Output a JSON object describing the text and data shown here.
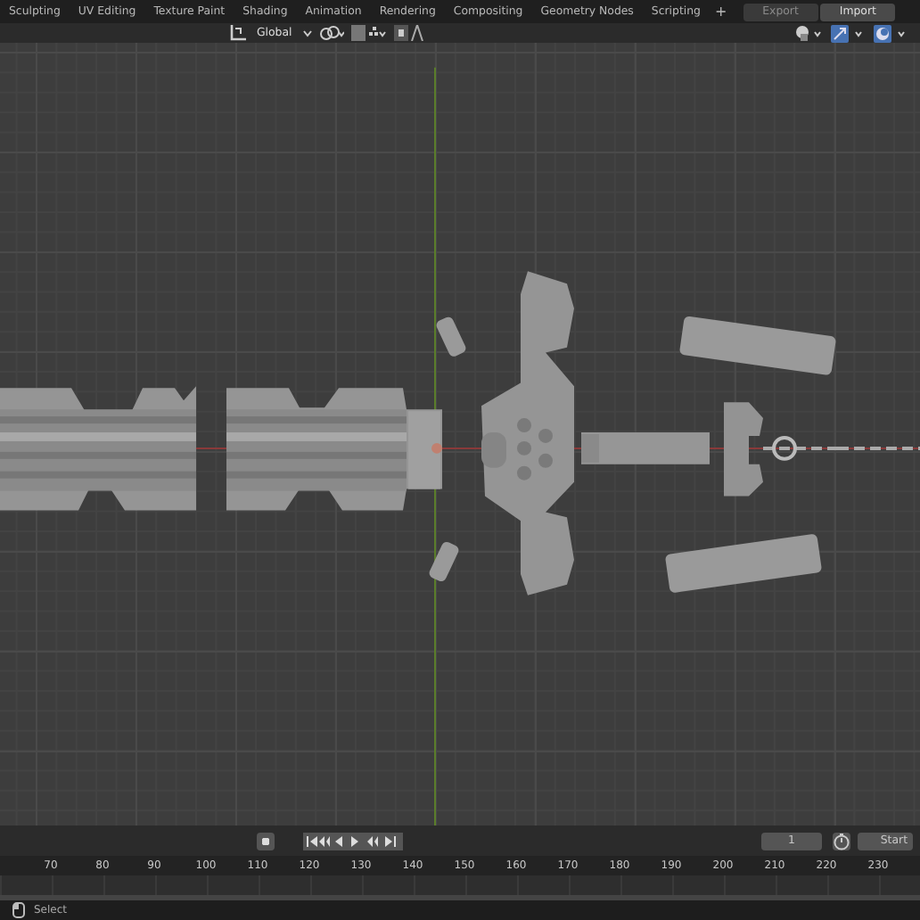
{
  "workspace_tabs": [
    {
      "label": "Sculpting",
      "selected": false
    },
    {
      "label": "UV Editing",
      "selected": false
    },
    {
      "label": "Texture Paint",
      "selected": false
    },
    {
      "label": "Shading",
      "selected": false
    },
    {
      "label": "Animation",
      "selected": false
    },
    {
      "label": "Rendering",
      "selected": false
    },
    {
      "label": "Compositing",
      "selected": false
    },
    {
      "label": "Geometry Nodes",
      "selected": false
    },
    {
      "label": "Scripting",
      "selected": false
    }
  ],
  "add_workspace": "+",
  "file_buttons": [
    "Export",
    "Import"
  ],
  "header": {
    "orientation": "Global"
  },
  "timeline": {
    "current_frame": "1",
    "range_label": "Start",
    "ruler": [
      "70",
      "80",
      "90",
      "100",
      "110",
      "120",
      "130",
      "140",
      "150",
      "160",
      "170",
      "180",
      "190",
      "200",
      "210",
      "220",
      "230"
    ]
  },
  "status_bar": {
    "hint": "Select"
  }
}
